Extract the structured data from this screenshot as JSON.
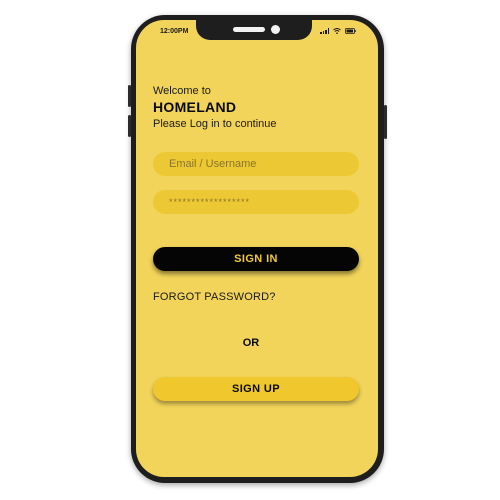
{
  "status_bar": {
    "time": "12:00PM",
    "icons": [
      "signal-icon",
      "wifi-icon",
      "battery-icon"
    ]
  },
  "login": {
    "welcome": "Welcome to",
    "app_name": "HOMELAND",
    "subtitle": "Please Log in to continue",
    "email_placeholder": "Email / Username",
    "password_placeholder": "******************",
    "sign_in_label": "SIGN IN",
    "forgot_password_label": "FORGOT PASSWORD?",
    "or_label": "OR",
    "sign_up_label": "SIGN UP"
  },
  "colors": {
    "screen_background": "#f2d45a",
    "field_background": "#ecc934",
    "primary_button": "#050505",
    "primary_button_text": "#f2c935",
    "secondary_button": "#f0c82e",
    "phone_frame": "#1e1e1e"
  }
}
